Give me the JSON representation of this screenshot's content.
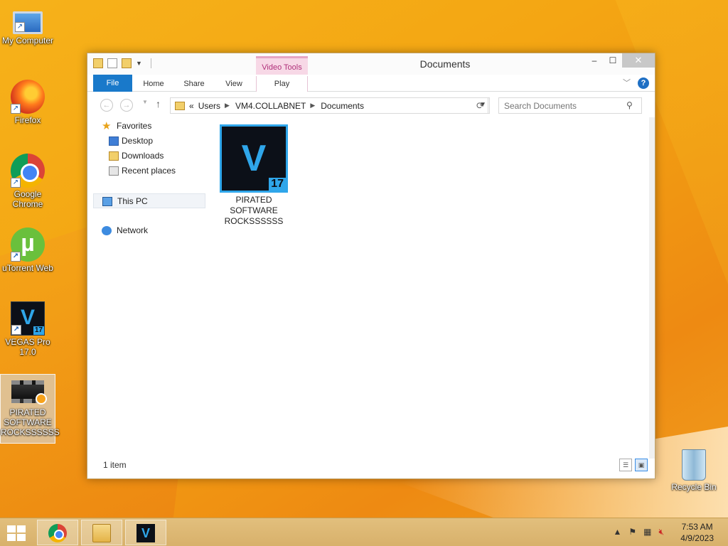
{
  "desktop": {
    "icons": [
      {
        "label": "My Computer"
      },
      {
        "label": "Firefox"
      },
      {
        "label": "Google Chrome"
      },
      {
        "label": "uTorrent Web"
      },
      {
        "label": "VEGAS Pro 17.0",
        "badge": "17",
        "glyph": "V"
      },
      {
        "label": "PIRATED SOFTWARE ROCKSSSSSS"
      }
    ],
    "recycle_bin": {
      "label": "Recycle Bin"
    }
  },
  "window": {
    "title": "Documents",
    "context_tab": "Video Tools",
    "controls": {
      "minimize": "‒",
      "maximize": "☐",
      "close": "✕"
    },
    "ribbon_tabs": {
      "file": "File",
      "home": "Home",
      "share": "Share",
      "view": "View",
      "play": "Play"
    },
    "help": "?",
    "address": {
      "prefix": "«",
      "crumbs": [
        "Users",
        "VM4.COLLABNET",
        "Documents"
      ]
    },
    "search_placeholder": "Search Documents",
    "nav": {
      "favorites": "Favorites",
      "desktop": "Desktop",
      "downloads": "Downloads",
      "recent": "Recent places",
      "this_pc": "This PC",
      "network": "Network"
    },
    "files": [
      {
        "name": "PIRATED SOFTWARE ROCKSSSSSS",
        "glyph": "V",
        "badge": "17"
      }
    ],
    "status": "1 item"
  },
  "taskbar": {
    "clock": {
      "time": "7:53 AM",
      "date": "4/9/2023"
    }
  },
  "colors": {
    "accent": "#1979ca",
    "vegas_blue": "#2fa6ea",
    "taskbar": "#dcb773",
    "context_tab": "#f7d8e6"
  },
  "icons": [
    "computer-icon",
    "firefox-icon",
    "chrome-icon",
    "utorrent-icon",
    "vegas-icon",
    "video-file-icon",
    "recycle-bin-icon",
    "folder-icon",
    "star-icon",
    "desktop-icon",
    "downloads-icon",
    "recent-places-icon",
    "pc-icon",
    "network-icon",
    "search-icon",
    "refresh-icon",
    "help-icon",
    "windows-icon"
  ]
}
